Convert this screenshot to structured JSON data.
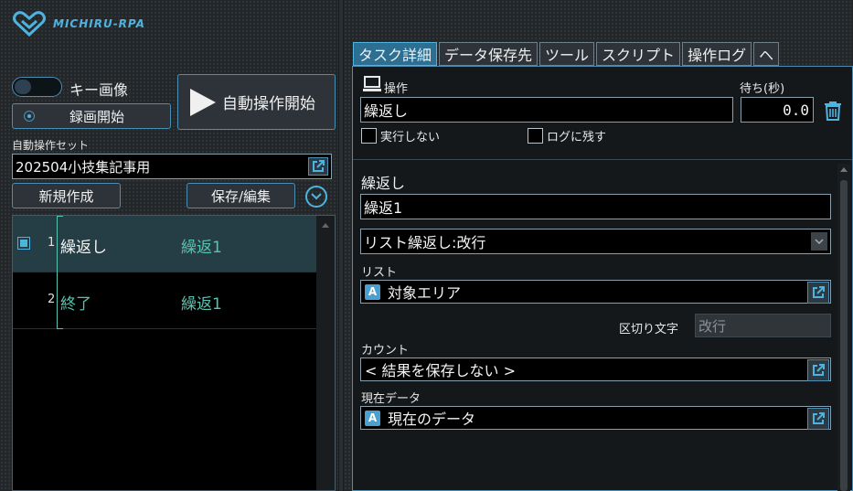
{
  "app": {
    "logo_text": "MICHIRU-RPA"
  },
  "left": {
    "toggle_label": "キー画像",
    "record_label": "録画開始",
    "auto_start_label": "自動操作開始",
    "set_label": "自動操作セット",
    "set_value": "202504小技集記事用",
    "new_label": "新規作成",
    "save_label": "保存/編集"
  },
  "tasks": [
    {
      "num": "1",
      "name": "繰返し",
      "label": "繰返1",
      "selected": true
    },
    {
      "num": "2",
      "name": "終了",
      "label": "繰返1",
      "selected": false
    }
  ],
  "tabs": [
    "タスク詳細",
    "データ保存先",
    "ツール",
    "スクリプト",
    "操作ログ",
    "ヘ"
  ],
  "detail": {
    "op_label": "操作",
    "op_value": "繰返し",
    "wait_label": "待ち(秒)",
    "wait_value": "0.0",
    "noexec_label": "実行しない",
    "nolog_label": "ログに残す",
    "section_title": "繰返し",
    "name_value": "繰返1",
    "type_value": "リスト繰返し:改行",
    "list_label": "リスト",
    "list_value": "対象エリア",
    "delim_label": "区切り文字",
    "delim_value": "改行",
    "count_label": "カウント",
    "count_value": "< 結果を保存しない >",
    "current_label": "現在データ",
    "current_value": "現在のデータ",
    "badge_text": "A"
  },
  "colors": {
    "accent": "#4fb3e0",
    "tab_active": "#2c6f93",
    "green_text": "#57c4b0"
  },
  "icons": [
    "logo-icon",
    "play-icon",
    "external-link-icon",
    "chevron-down-icon",
    "laptop-icon",
    "trash-icon"
  ]
}
